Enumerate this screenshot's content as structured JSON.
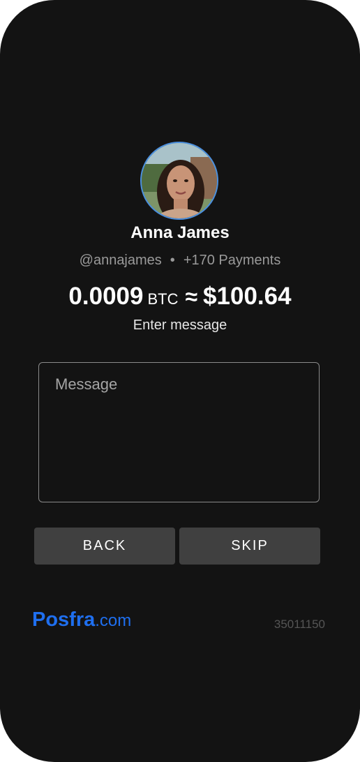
{
  "recipient": {
    "name": "Anna James",
    "handle": "@annajames",
    "separator": "•",
    "payments": "+170 Payments"
  },
  "amount": {
    "crypto_value": "0.0009",
    "crypto_unit": "BTC",
    "approx_symbol": "≈",
    "fiat_value": "$100.64"
  },
  "message": {
    "prompt": "Enter message",
    "placeholder": "Message",
    "value": ""
  },
  "buttons": {
    "back_label": "BACK",
    "skip_label": "SKIP"
  },
  "footer": {
    "logo_brand": "Posfra",
    "logo_tld": ".com",
    "reference": "35011150"
  },
  "colors": {
    "background": "#131313",
    "button": "#404040",
    "brand_blue": "#1f6fef",
    "avatar_ring": "#4a8fe0"
  }
}
